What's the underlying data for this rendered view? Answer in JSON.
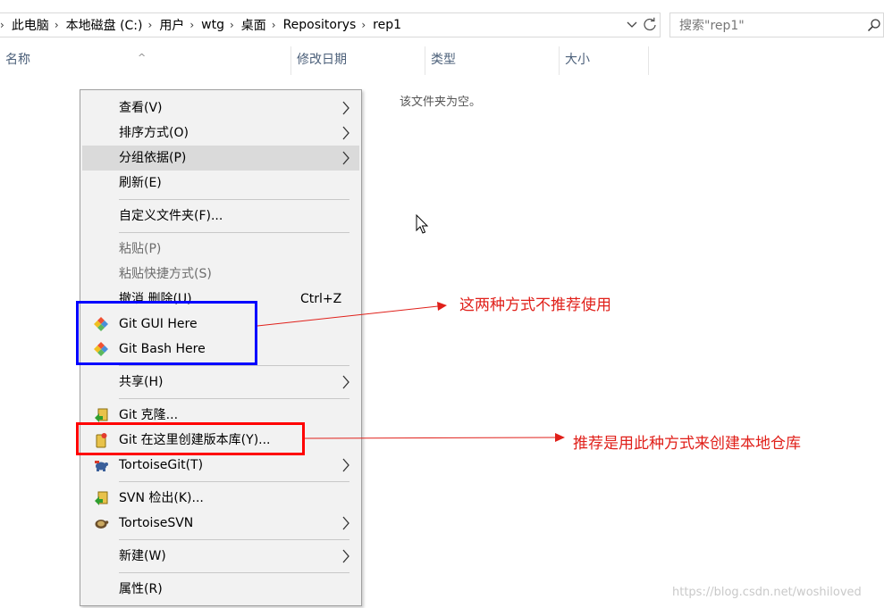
{
  "address_bar": {
    "crumbs": [
      "此电脑",
      "本地磁盘 (C:)",
      "用户",
      "wtg",
      "桌面",
      "Repositorys",
      "rep1"
    ]
  },
  "search": {
    "placeholder": "搜索\"rep1\""
  },
  "columns": {
    "name": "名称",
    "date": "修改日期",
    "type": "类型",
    "size": "大小"
  },
  "empty_message": "该文件夹为空。",
  "context_menu": {
    "items": [
      {
        "label": "查看(V)",
        "submenu": true
      },
      {
        "label": "排序方式(O)",
        "submenu": true
      },
      {
        "label": "分组依据(P)",
        "submenu": true,
        "highlighted": true
      },
      {
        "label": "刷新(E)"
      },
      {
        "label": "自定义文件夹(F)..."
      },
      {
        "label": "粘贴(P)",
        "disabled": true
      },
      {
        "label": "粘贴快捷方式(S)",
        "disabled": true
      },
      {
        "label": "撤消 删除(U)",
        "shortcut": "Ctrl+Z"
      },
      {
        "label": "Git GUI Here",
        "icon": "git-diamond-icon"
      },
      {
        "label": "Git Bash Here",
        "icon": "git-diamond-icon"
      },
      {
        "label": "共享(H)",
        "submenu": true
      },
      {
        "label": "Git 克隆...",
        "icon": "tortoisegit-clone-icon"
      },
      {
        "label": "Git 在这里创建版本库(Y)...",
        "icon": "tortoisegit-create-repo-icon"
      },
      {
        "label": "TortoiseGit(T)",
        "submenu": true,
        "icon": "tortoisegit-icon"
      },
      {
        "label": "SVN 检出(K)...",
        "icon": "svn-checkout-icon"
      },
      {
        "label": "TortoiseSVN",
        "submenu": true,
        "icon": "tortoisesvn-icon"
      },
      {
        "label": "新建(W)",
        "submenu": true
      },
      {
        "label": "属性(R)"
      }
    ]
  },
  "annotations": {
    "not_recommended": "这两种方式不推荐使用",
    "recommended": "推荐是用此种方式来创建本地仓库"
  },
  "watermark": "https://blog.csdn.net/woshiloved",
  "colors": {
    "menu_bg": "#f2f2f2",
    "menu_highlight": "#dadada",
    "blue_box": "#0000ff",
    "red_box": "#ff0000",
    "annotation_text": "#e0201a"
  }
}
